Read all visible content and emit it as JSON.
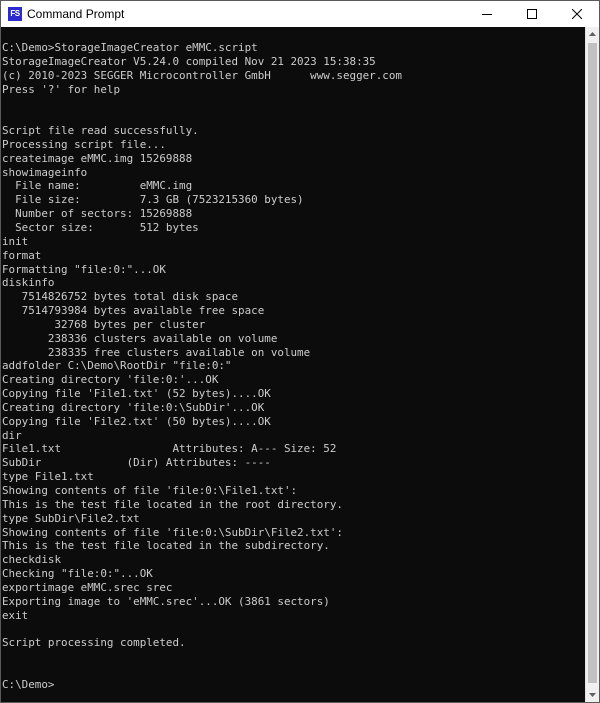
{
  "window": {
    "title": "Command Prompt",
    "icon_label": "FS",
    "icon_color": "#2b2bd0"
  },
  "controls": {
    "minimize_icon": "minimize-icon",
    "maximize_icon": "maximize-icon",
    "close_icon": "close-icon"
  },
  "console": {
    "background": "#0c0c0c",
    "foreground": "#cccccc",
    "lines": [
      "C:\\Demo>StorageImageCreator eMMC.script",
      "StorageImageCreator V5.24.0 compiled Nov 21 2023 15:38:35",
      "(c) 2010-2023 SEGGER Microcontroller GmbH      www.segger.com",
      "Press '?' for help",
      "",
      "",
      "Script file read successfully.",
      "Processing script file...",
      "createimage eMMC.img 15269888",
      "showimageinfo",
      "  File name:         eMMC.img",
      "  File size:         7.3 GB (7523215360 bytes)",
      "  Number of sectors: 15269888",
      "  Sector size:       512 bytes",
      "init",
      "format",
      "Formatting \"file:0:\"...OK",
      "diskinfo",
      "   7514826752 bytes total disk space",
      "   7514793984 bytes available free space",
      "        32768 bytes per cluster",
      "       238336 clusters available on volume",
      "       238335 free clusters available on volume",
      "addfolder C:\\Demo\\RootDir \"file:0:\"",
      "Creating directory 'file:0:'...OK",
      "Copying file 'File1.txt' (52 bytes)....OK",
      "Creating directory 'file:0:\\SubDir'...OK",
      "Copying file 'File2.txt' (50 bytes)....OK",
      "dir",
      "File1.txt                 Attributes: A--- Size: 52",
      "SubDir             (Dir) Attributes: ----",
      "type File1.txt",
      "Showing contents of file 'file:0:\\File1.txt':",
      "This is the test file located in the root directory.",
      "type SubDir\\File2.txt",
      "Showing contents of file 'file:0:\\SubDir\\File2.txt':",
      "This is the test file located in the subdirectory.",
      "checkdisk",
      "Checking \"file:0:\"...OK",
      "exportimage eMMC.srec srec",
      "Exporting image to 'eMMC.srec'...OK (3861 sectors)",
      "exit",
      "",
      "Script processing completed.",
      "",
      "",
      "C:\\Demo>"
    ]
  }
}
